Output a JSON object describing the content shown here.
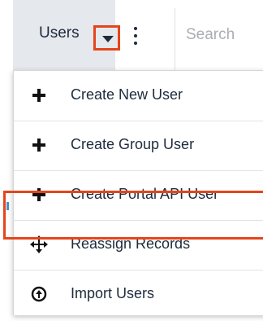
{
  "header": {
    "module_tab_label": "Users",
    "search_placeholder": "Search"
  },
  "icons": {
    "module_dropdown": "caret-down-icon",
    "more_actions": "kebab-vertical-icon"
  },
  "dropdown_menu": {
    "items": [
      {
        "label": "Create New User",
        "icon": "plus-icon"
      },
      {
        "label": "Create Group User",
        "icon": "plus-icon"
      },
      {
        "label": "Create Portal API User",
        "icon": "plus-icon"
      },
      {
        "label": "Reassign Records",
        "icon": "move-arrows-icon"
      },
      {
        "label": "Import Users",
        "icon": "circle-arrow-up-icon",
        "highlighted": true
      }
    ]
  },
  "colors": {
    "highlight": "#e5451b",
    "tab_background": "#e5e8ec",
    "text": "#1e2b3c",
    "placeholder": "#a9adb3"
  }
}
